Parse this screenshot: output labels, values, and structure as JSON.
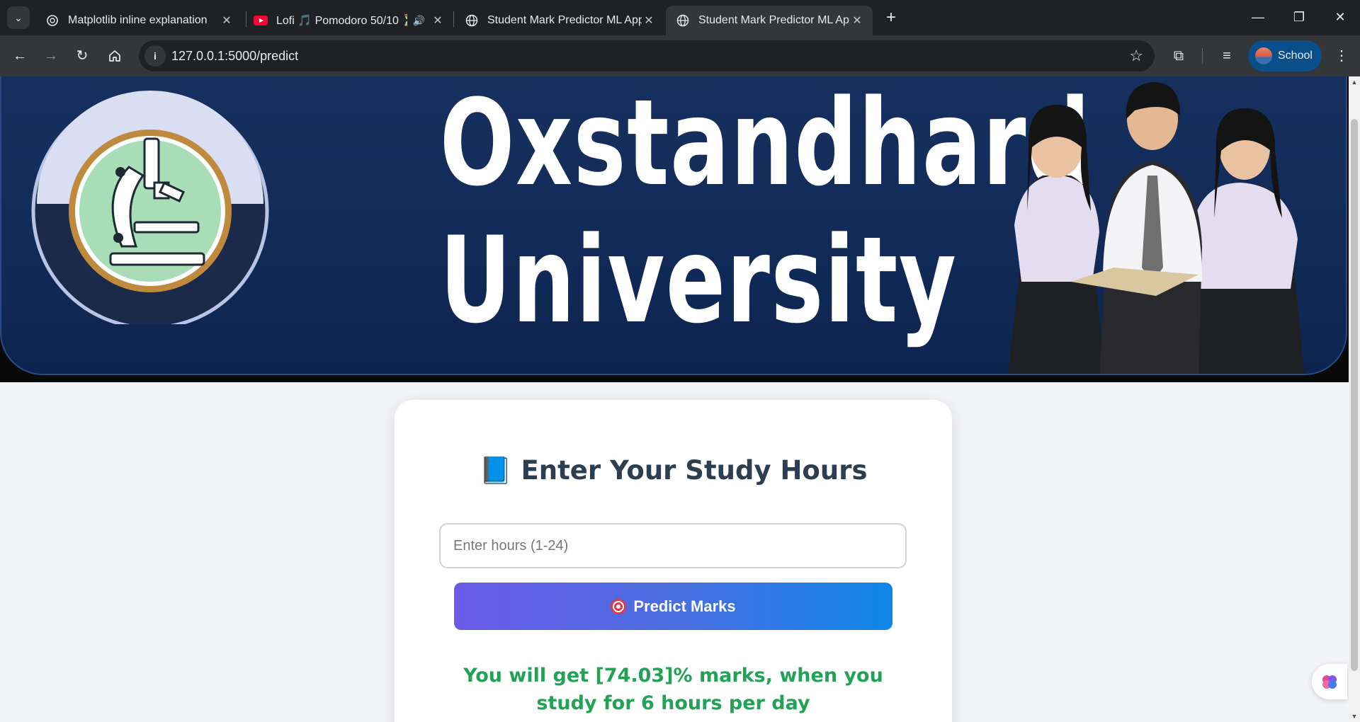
{
  "browser": {
    "tabs": [
      {
        "title": "Matplotlib inline explanation",
        "icon": "openai-icon"
      },
      {
        "title": "Lofi 🎵 Pomodoro 50/10 ⏳",
        "icon": "youtube-icon"
      },
      {
        "title": "Student Mark Predictor ML App",
        "icon": "globe-icon"
      },
      {
        "title": "Student Mark Predictor ML App",
        "icon": "globe-icon",
        "active": true
      }
    ],
    "url": "127.0.0.1:5000/predict",
    "profile_label": "School"
  },
  "banner": {
    "title_line1": "Oxstandhard",
    "title_line2": "University"
  },
  "form": {
    "heading_icon": "📘",
    "heading": "Enter Your Study Hours",
    "input_placeholder": "Enter hours (1-24)",
    "button_label": "Predict Marks"
  },
  "result": {
    "text": "You will get [74.03]% marks, when you study for 6 hours per day"
  },
  "colors": {
    "accent_start": "#6a5ae6",
    "accent_end": "#0e86e8",
    "result": "#22a257",
    "banner": "#17305f"
  }
}
